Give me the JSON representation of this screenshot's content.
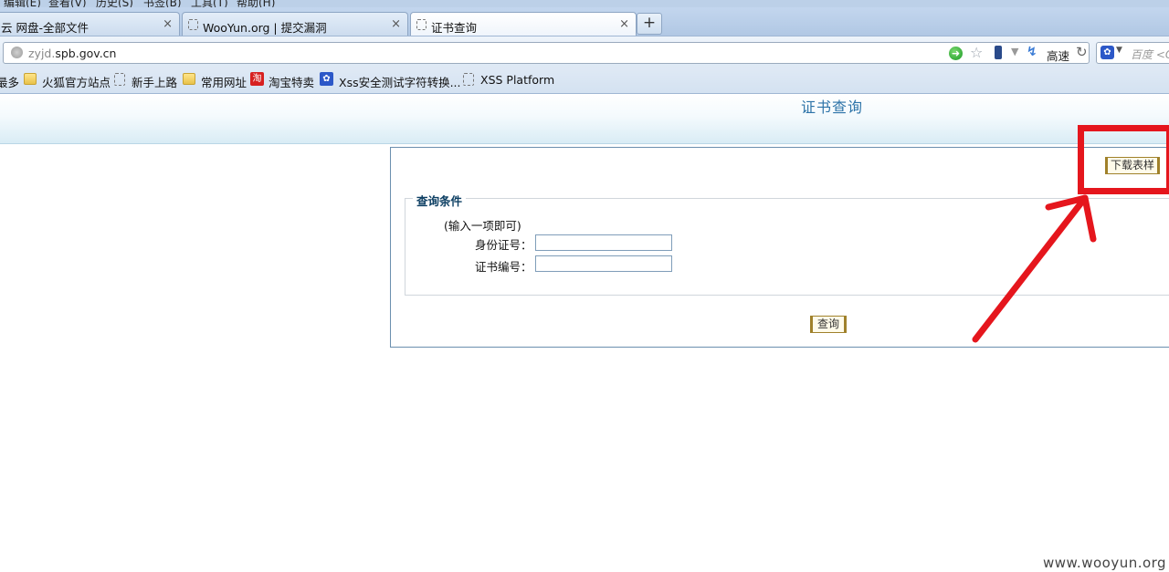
{
  "browser": {
    "menu": [
      "编辑(E)",
      "查看(V)",
      "历史(S)",
      "书签(B)",
      "工具(T)",
      "帮助(H)"
    ],
    "tabs": [
      {
        "label": "云 网盘-全部文件",
        "close": "×"
      },
      {
        "label": "WooYun.org | 提交漏洞",
        "close": "×"
      },
      {
        "label": "证书查询",
        "close": "×"
      }
    ],
    "new_tab": "+",
    "url_host_dim": "zyjd.",
    "url_host": "spb.gov.cn",
    "speed_label": "高速",
    "search_placeholder": "百度 <Ctrl+K>",
    "bookmarks": [
      "最多",
      "火狐官方站点",
      "新手上路",
      "常用网址",
      "淘宝特卖",
      "Xss安全测试字符转换...",
      "XSS Platform"
    ]
  },
  "page": {
    "heading": "证书查询",
    "download_button": "下载表样",
    "legend": "查询条件",
    "hint": "(输入一项即可)",
    "fields": [
      {
        "label": "身份证号：",
        "value": ""
      },
      {
        "label": "证书编号：",
        "value": ""
      }
    ],
    "query_button": "查询"
  },
  "annotation": {
    "color": "#e5161d"
  },
  "watermark": "www.wooyun.org"
}
